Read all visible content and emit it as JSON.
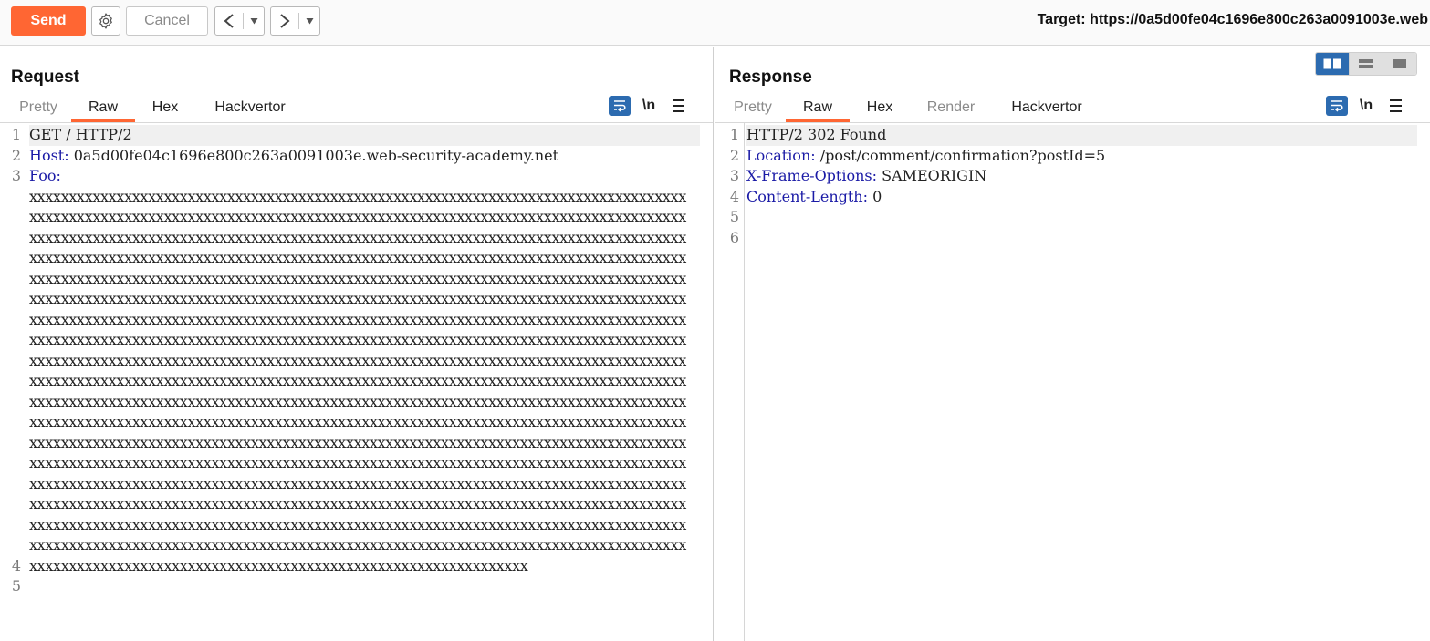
{
  "toolbar": {
    "send_label": "Send",
    "cancel_label": "Cancel",
    "back_glyph": "<",
    "forward_glyph": ">",
    "dropdown_glyph": "▾",
    "target_text": "Target: https://0a5d00fe04c1696e800c263a0091003e.web",
    "send_color": "#ff6633"
  },
  "request": {
    "title": "Request",
    "tabs": [
      {
        "label": "Pretty",
        "active": false,
        "muted": true
      },
      {
        "label": "Raw",
        "active": true,
        "muted": false
      },
      {
        "label": "Hex",
        "active": false,
        "muted": false
      },
      {
        "label": "Hackvertor",
        "active": false,
        "muted": false
      }
    ],
    "newline_toggle": "\\n",
    "line_numbers": [
      "1",
      "2",
      "3",
      "4",
      "5"
    ],
    "lines": {
      "l1": "GET / HTTP/2",
      "l2_key": "Host:",
      "l2_val": " 0a5d00fe04c1696e800c263a0091003e.web-security-academy.net",
      "l3_key": "Foo:"
    },
    "foo_rows": [
      "xxxxxxxxxxxxxxxxxxxxxxxxxxxxxxxxxxxxxxxxxxxxxxxxxxxxxxxxxxxxxxxxxxxxxxxxxxxxxxxxxxx",
      "xxxxxxxxxxxxxxxxxxxxxxxxxxxxxxxxxxxxxxxxxxxxxxxxxxxxxxxxxxxxxxxxxxxxxxxxxxxxxxxxxxx",
      "xxxxxxxxxxxxxxxxxxxxxxxxxxxxxxxxxxxxxxxxxxxxxxxxxxxxxxxxxxxxxxxxxxxxxxxxxxxxxxxxxxx",
      "xxxxxxxxxxxxxxxxxxxxxxxxxxxxxxxxxxxxxxxxxxxxxxxxxxxxxxxxxxxxxxxxxxxxxxxxxxxxxxxxxxx",
      "xxxxxxxxxxxxxxxxxxxxxxxxxxxxxxxxxxxxxxxxxxxxxxxxxxxxxxxxxxxxxxxxxxxxxxxxxxxxxxxxxxx",
      "xxxxxxxxxxxxxxxxxxxxxxxxxxxxxxxxxxxxxxxxxxxxxxxxxxxxxxxxxxxxxxxxxxxxxxxxxxxxxxxxxxx",
      "xxxxxxxxxxxxxxxxxxxxxxxxxxxxxxxxxxxxxxxxxxxxxxxxxxxxxxxxxxxxxxxxxxxxxxxxxxxxxxxxxxx",
      "xxxxxxxxxxxxxxxxxxxxxxxxxxxxxxxxxxxxxxxxxxxxxxxxxxxxxxxxxxxxxxxxxxxxxxxxxxxxxxxxxxx",
      "xxxxxxxxxxxxxxxxxxxxxxxxxxxxxxxxxxxxxxxxxxxxxxxxxxxxxxxxxxxxxxxxxxxxxxxxxxxxxxxxxxx",
      "xxxxxxxxxxxxxxxxxxxxxxxxxxxxxxxxxxxxxxxxxxxxxxxxxxxxxxxxxxxxxxxxxxxxxxxxxxxxxxxxxxx",
      "xxxxxxxxxxxxxxxxxxxxxxxxxxxxxxxxxxxxxxxxxxxxxxxxxxxxxxxxxxxxxxxxxxxxxxxxxxxxxxxxxxx",
      "xxxxxxxxxxxxxxxxxxxxxxxxxxxxxxxxxxxxxxxxxxxxxxxxxxxxxxxxxxxxxxxxxxxxxxxxxxxxxxxxxxx",
      "xxxxxxxxxxxxxxxxxxxxxxxxxxxxxxxxxxxxxxxxxxxxxxxxxxxxxxxxxxxxxxxxxxxxxxxxxxxxxxxxxxx",
      "xxxxxxxxxxxxxxxxxxxxxxxxxxxxxxxxxxxxxxxxxxxxxxxxxxxxxxxxxxxxxxxxxxxxxxxxxxxxxxxxxxx",
      "xxxxxxxxxxxxxxxxxxxxxxxxxxxxxxxxxxxxxxxxxxxxxxxxxxxxxxxxxxxxxxxxxxxxxxxxxxxxxxxxxxx",
      "xxxxxxxxxxxxxxxxxxxxxxxxxxxxxxxxxxxxxxxxxxxxxxxxxxxxxxxxxxxxxxxxxxxxxxxxxxxxxxxxxxx",
      "xxxxxxxxxxxxxxxxxxxxxxxxxxxxxxxxxxxxxxxxxxxxxxxxxxxxxxxxxxxxxxxxxxxxxxxxxxxxxxxxxxx",
      "xxxxxxxxxxxxxxxxxxxxxxxxxxxxxxxxxxxxxxxxxxxxxxxxxxxxxxxxxxxxxxxxxxxxxxxxxxxxxxxxxxx",
      "xxxxxxxxxxxxxxxxxxxxxxxxxxxxxxxxxxxxxxxxxxxxxxxxxxxxxxxxxxxxxxx"
    ]
  },
  "response": {
    "title": "Response",
    "tabs": [
      {
        "label": "Pretty",
        "active": false,
        "muted": true
      },
      {
        "label": "Raw",
        "active": true,
        "muted": false
      },
      {
        "label": "Hex",
        "active": false,
        "muted": false
      },
      {
        "label": "Render",
        "active": false,
        "muted": true
      },
      {
        "label": "Hackvertor",
        "active": false,
        "muted": false
      }
    ],
    "newline_toggle": "\\n",
    "line_numbers": [
      "1",
      "2",
      "3",
      "4",
      "5",
      "6"
    ],
    "lines": {
      "l1": "HTTP/2 302 Found",
      "l2_key": "Location:",
      "l2_val": " /post/comment/confirmation?postId=5",
      "l3_key": "X-Frame-Options:",
      "l3_val": " SAMEORIGIN",
      "l4_key": "Content-Length:",
      "l4_val": " 0"
    }
  },
  "colors": {
    "accent": "#ff6633",
    "header_key": "#1a1aa6",
    "toggle_blue": "#2c6bb0"
  }
}
